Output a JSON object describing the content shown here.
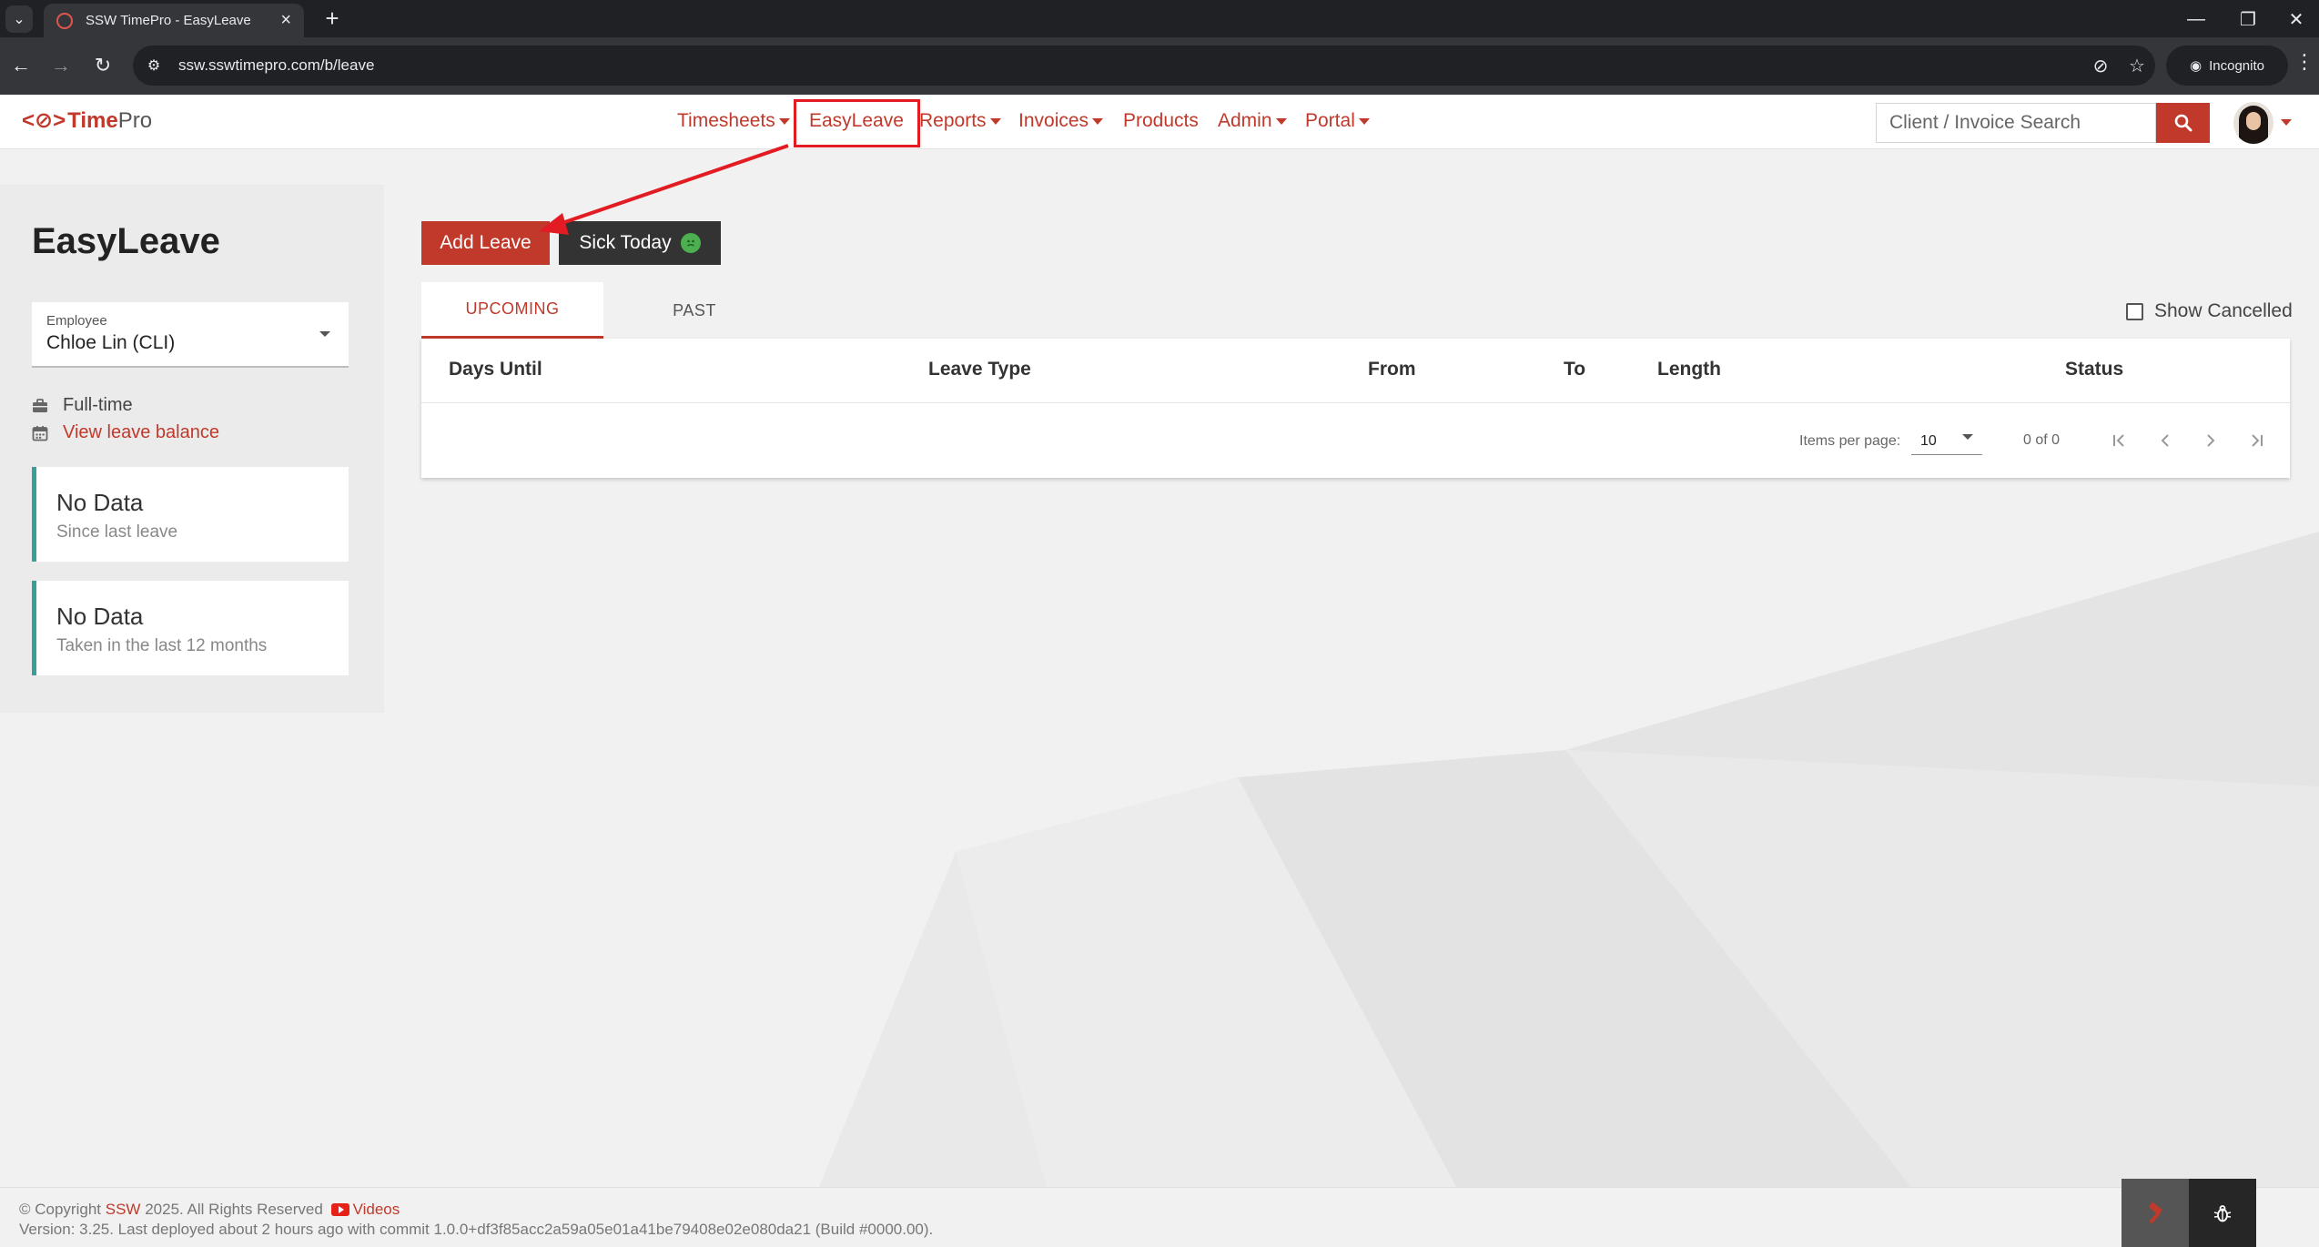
{
  "browser": {
    "tab_title": "SSW TimePro - EasyLeave",
    "url": "ssw.sswtimepro.com/b/leave",
    "incognito_label": "Incognito"
  },
  "navbar": {
    "logo_mark": "<⊘>",
    "logo_time": "Time",
    "logo_pro": "Pro",
    "items": [
      {
        "label": "Timesheets"
      },
      {
        "label": "EasyLeave"
      },
      {
        "label": "Reports"
      },
      {
        "label": "Invoices"
      },
      {
        "label": "Products"
      },
      {
        "label": "Admin"
      },
      {
        "label": "Portal"
      }
    ],
    "search_placeholder": "Client / Invoice Search"
  },
  "sidebar": {
    "title": "EasyLeave",
    "employee_label": "Employee",
    "employee_value": "Chloe Lin (CLI)",
    "employment_type": "Full-time",
    "leave_balance_link": "View leave balance",
    "cards": [
      {
        "title": "No Data",
        "subtitle": "Since last leave"
      },
      {
        "title": "No Data",
        "subtitle": "Taken in the last 12 months"
      }
    ]
  },
  "main": {
    "add_leave_label": "Add Leave",
    "sick_today_label": "Sick Today",
    "tabs": [
      {
        "label": "UPCOMING"
      },
      {
        "label": "PAST"
      }
    ],
    "show_cancelled_label": "Show Cancelled",
    "table": {
      "columns": [
        "Days Until",
        "Leave Type",
        "From",
        "To",
        "Length",
        "Status"
      ]
    },
    "paginator": {
      "items_per_page_label": "Items per page:",
      "page_size": "10",
      "range_label": "0 of 0"
    }
  },
  "footer": {
    "copyright_prefix": "© Copyright",
    "company": "SSW",
    "copyright_suffix": "2025. All Rights Reserved",
    "videos_label": "Videos",
    "version": "Version: 3.25. Last deployed about 2 hours ago with commit 1.0.0+df3f85acc2a59a05e01a41be79408e02e080da21 (Build #0000.00)."
  },
  "colors": {
    "accent": "#c0392b",
    "annotation": "#e31b23",
    "card_border": "#3a9e9a",
    "dark_button": "#333333"
  },
  "icons": [
    "chevron-down-icon",
    "close-icon",
    "plus-icon",
    "back-icon",
    "forward-icon",
    "reload-icon",
    "site-settings-icon",
    "eye-off-icon",
    "star-icon",
    "incognito-icon",
    "kebab-icon",
    "search-icon",
    "briefcase-icon",
    "calendar-icon",
    "sick-face-icon",
    "first-page-icon",
    "prev-page-icon",
    "next-page-icon",
    "last-page-icon",
    "hammer-icon",
    "bug-icon"
  ]
}
